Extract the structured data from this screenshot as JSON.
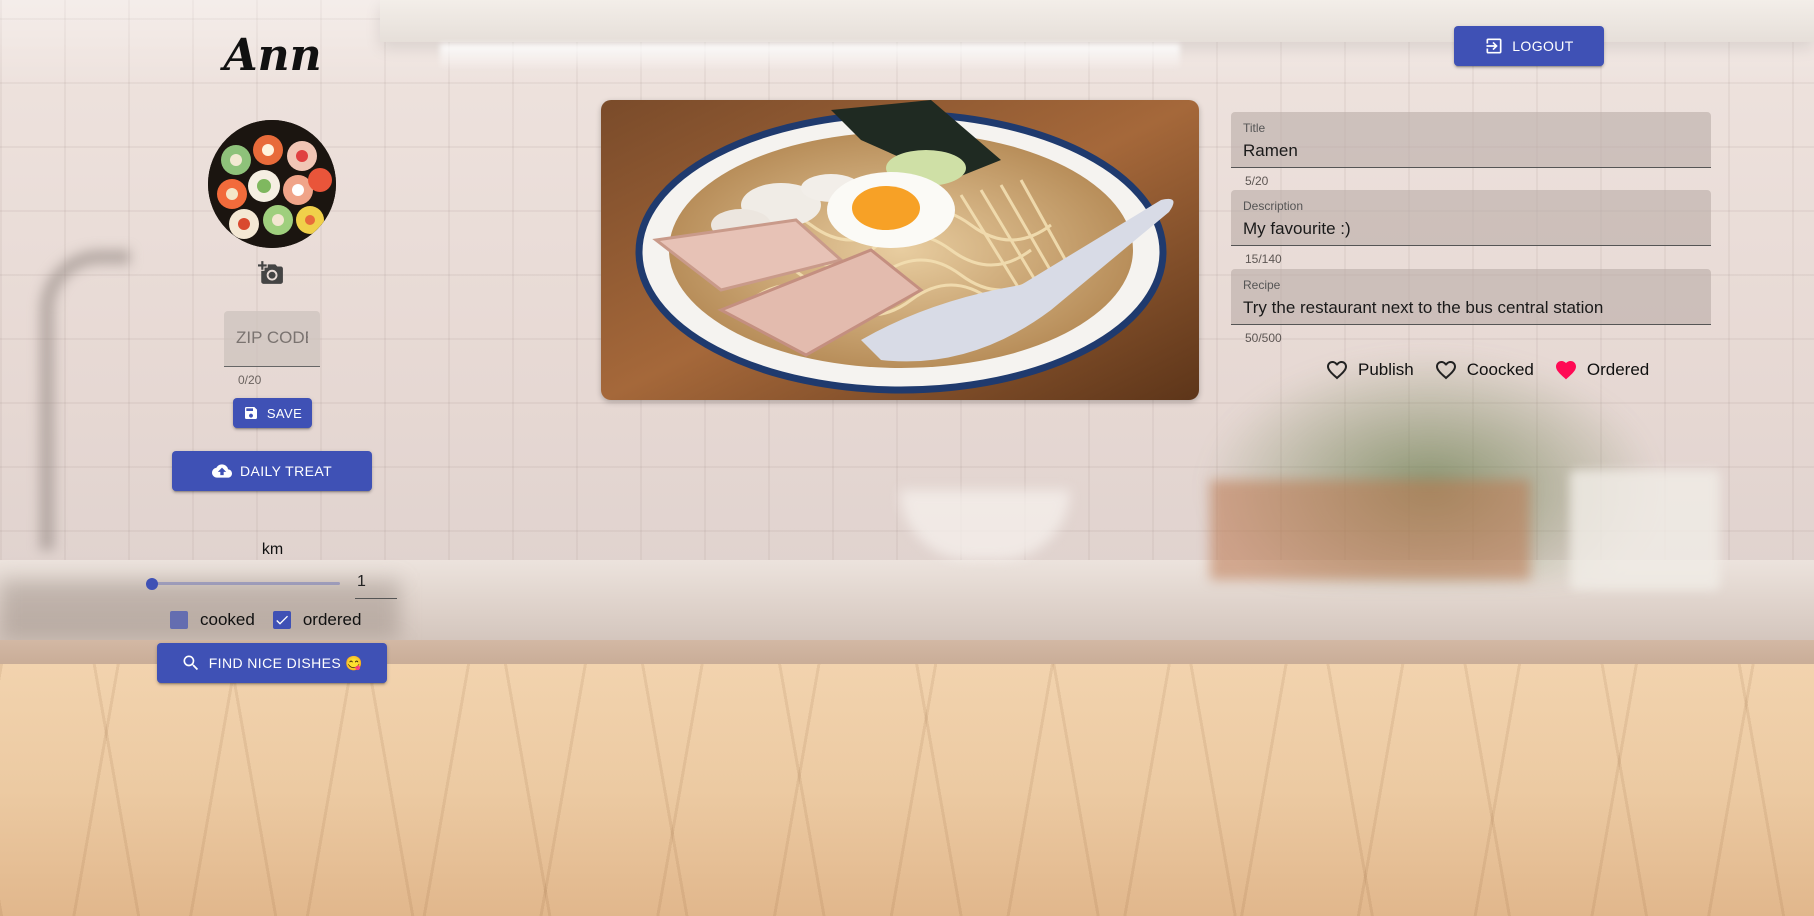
{
  "profile": {
    "name": "Ann",
    "avatar_icon": "sushi-plate-photo",
    "add_photo_icon": "add-a-photo-icon"
  },
  "zip": {
    "placeholder": "ZIP CODE",
    "value": "",
    "counter": "0/20"
  },
  "buttons": {
    "save": "SAVE",
    "daily_treat": "DAILY TREAT",
    "find": "FIND NICE DISHES 😋",
    "logout": "LOGOUT"
  },
  "filter": {
    "unit_label": "km",
    "distance_value": "1",
    "slider_fraction": 0.0,
    "checkboxes": [
      {
        "label": "cooked",
        "checked": true
      },
      {
        "label": "ordered",
        "checked": true
      }
    ]
  },
  "dish": {
    "image_icon": "ramen-bowl-photo",
    "fields": [
      {
        "label": "Title",
        "value": "Ramen",
        "counter": "5/20"
      },
      {
        "label": "Description",
        "value": "My favourite :)",
        "counter": "15/140"
      },
      {
        "label": "Recipe",
        "value": "Try the restaurant next to the bus central station",
        "counter": "50/500"
      }
    ],
    "actions": [
      {
        "label": "Publish",
        "active": false
      },
      {
        "label": "Coocked",
        "active": false
      },
      {
        "label": "Ordered",
        "active": true
      }
    ]
  },
  "colors": {
    "primary": "#3f51b5",
    "heart_active": "#ff0a54"
  }
}
